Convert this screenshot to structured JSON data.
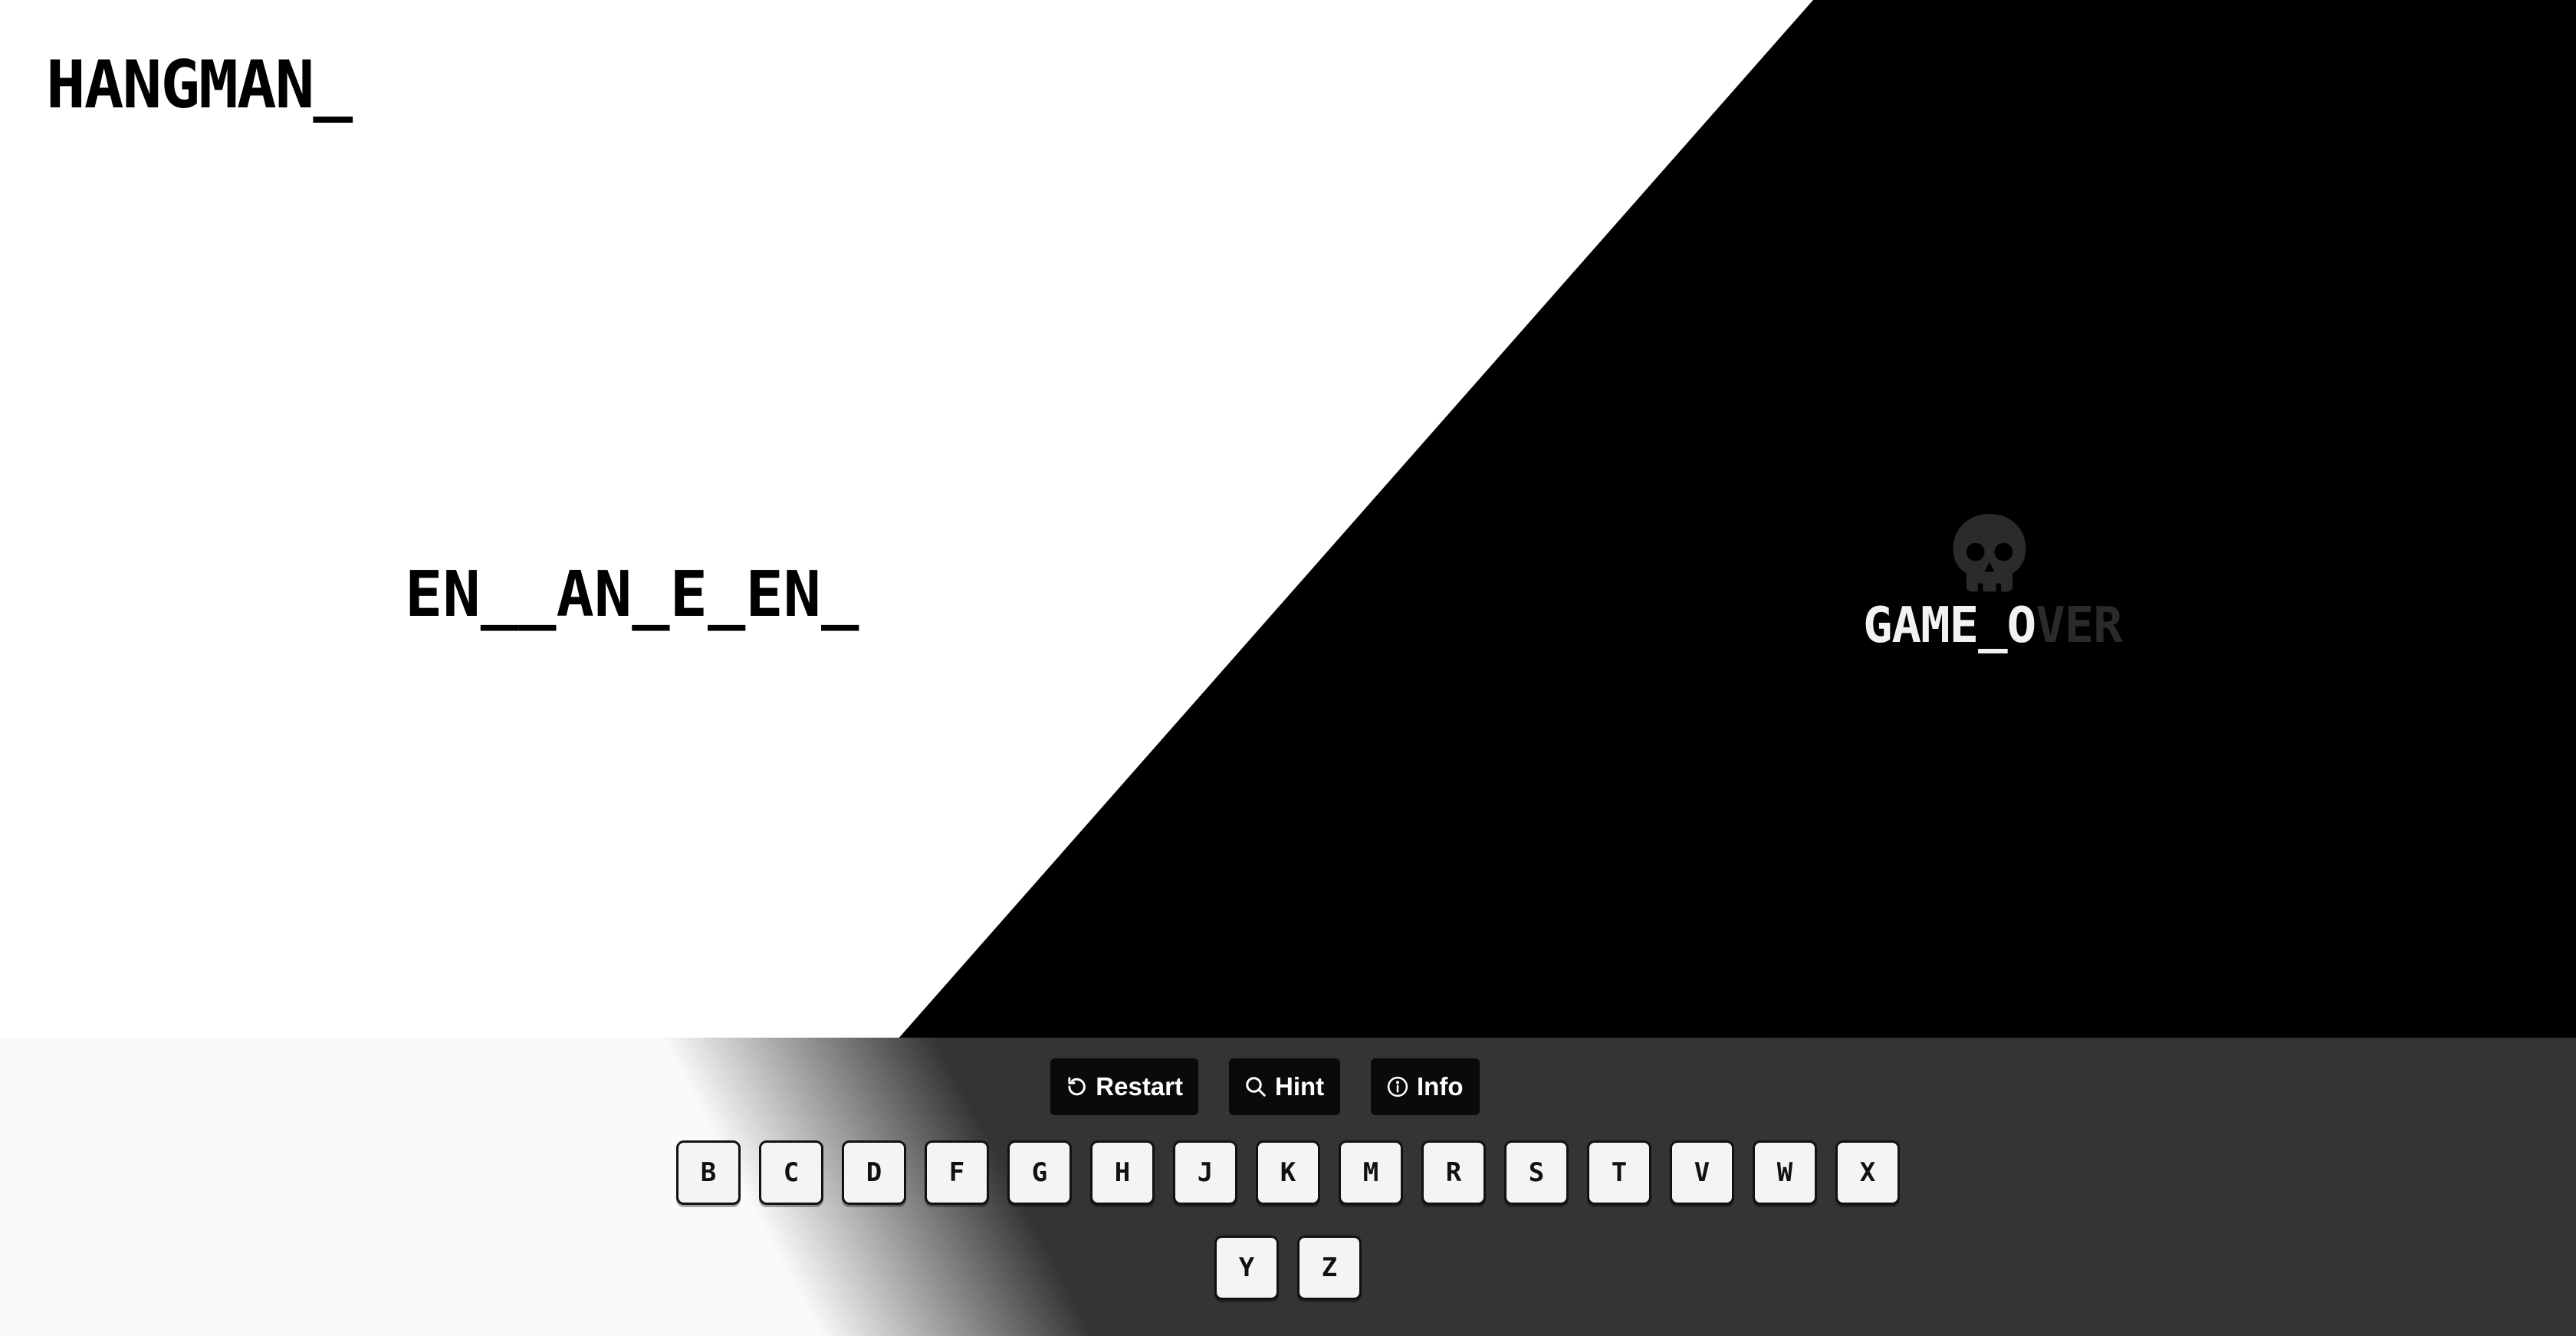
{
  "app": {
    "title": "HANGMAN_"
  },
  "game": {
    "word_display": "EN__AN_E_EN_",
    "game_over_lit": "GAME_O",
    "game_over_dim": "VER",
    "status_icon": "skull-icon"
  },
  "controls": {
    "restart": {
      "label": "Restart",
      "icon": "restart-icon"
    },
    "hint": {
      "label": "Hint",
      "icon": "search-icon"
    },
    "info": {
      "label": "Info",
      "icon": "info-icon"
    }
  },
  "keyboard": {
    "row1": [
      "B",
      "C",
      "D",
      "F",
      "G",
      "H",
      "J",
      "K",
      "M",
      "R",
      "S",
      "T",
      "V",
      "W",
      "X"
    ],
    "row2": [
      "Y",
      "Z"
    ]
  },
  "colors": {
    "background": "#ffffff",
    "dark_panel": "#000000",
    "bottom_bar": "#333333",
    "button_bg": "#0a0a0a",
    "key_bg": "#f4f4f4"
  }
}
